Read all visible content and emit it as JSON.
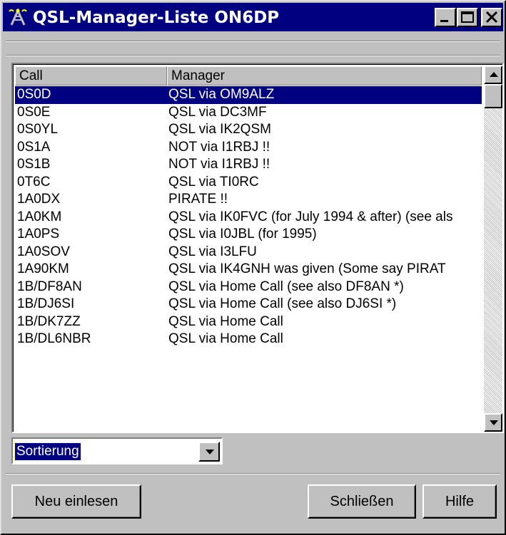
{
  "window": {
    "title": "QSL-Manager-Liste ON6DP",
    "titlebar_color": "#000080"
  },
  "list": {
    "columns": [
      "Call",
      "Manager"
    ],
    "selected_index": 0,
    "selected_color": "#000080",
    "rows": [
      {
        "call": "0S0D",
        "manager": "QSL via OM9ALZ"
      },
      {
        "call": "0S0E",
        "manager": "QSL via DC3MF"
      },
      {
        "call": "0S0YL",
        "manager": "QSL via IK2QSM"
      },
      {
        "call": "0S1A",
        "manager": "NOT via I1RBJ !!"
      },
      {
        "call": "0S1B",
        "manager": "NOT via I1RBJ !!"
      },
      {
        "call": "0T6C",
        "manager": "QSL via TI0RC"
      },
      {
        "call": "1A0DX",
        "manager": "PIRATE !!"
      },
      {
        "call": "1A0KM",
        "manager": "QSL via IK0FVC (for July 1994 & after) (see als"
      },
      {
        "call": "1A0PS",
        "manager": "QSL via I0JBL (for 1995)"
      },
      {
        "call": "1A0SOV",
        "manager": "QSL via I3LFU"
      },
      {
        "call": "1A90KM",
        "manager": "QSL via IK4GNH was given (Some say PIRAT"
      },
      {
        "call": "1B/DF8AN",
        "manager": "QSL via Home Call (see also DF8AN *)"
      },
      {
        "call": "1B/DJ6SI",
        "manager": "QSL via Home Call (see also DJ6SI *)"
      },
      {
        "call": "1B/DK7ZZ",
        "manager": "QSL via Home Call"
      },
      {
        "call": "1B/DL6NBR",
        "manager": "QSL via Home Call"
      }
    ]
  },
  "sort": {
    "selected_value": "Sortierung"
  },
  "buttons": {
    "reload_label": "Neu einlesen",
    "close_label": "Schließen",
    "help_label": "Hilfe"
  },
  "icons": {
    "app": "antenna-icon",
    "minimize": "minimize-icon",
    "maximize": "maximize-icon",
    "close": "close-icon",
    "scroll_up": "arrow-up-icon",
    "scroll_down": "arrow-down-icon",
    "dropdown": "chevron-down-icon"
  }
}
